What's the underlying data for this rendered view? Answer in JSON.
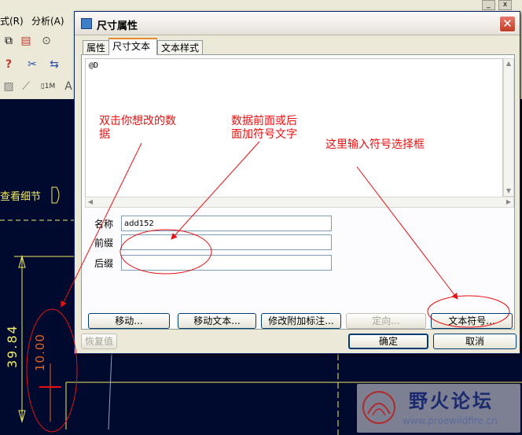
{
  "app": {
    "menus": [
      "式(R)",
      "分析(A)"
    ],
    "detail_label": "查看细节",
    "dimension_values": [
      "39.84",
      "10.00"
    ],
    "toolbar_icons": [
      "copy-icon",
      "pdf-icon",
      "print-preview-icon",
      "help-query-icon",
      "dimension-tool-icon",
      "table-tool-icon",
      "hatch-icon",
      "ruler-icon",
      "scale-icon",
      "annotation-icon"
    ],
    "window_controls": [
      "minimize",
      "close"
    ]
  },
  "dialog": {
    "title": "尺寸属性",
    "tabs": [
      "属性",
      "尺寸文本",
      "文本样式"
    ],
    "active_tab": "尺寸文本",
    "text_value": "@D",
    "fields": {
      "name_label": "名称",
      "name_value": "add152",
      "prefix_label": "前缀",
      "prefix_value": "",
      "suffix_label": "后缀",
      "suffix_value": ""
    },
    "buttons": {
      "move": "移动...",
      "move_text": "移动文本...",
      "modify_attached": "修改附加标注...",
      "orient": "定向...",
      "text_symbol": "文本符号...",
      "restore": "恢复值",
      "ok": "确定",
      "cancel": "取消"
    }
  },
  "annotations": {
    "double_click": "双击你想改的数\n据",
    "prefix_suffix": "数据前面或后\n面加符号文字",
    "symbol_box": "这里输入符号选择框"
  },
  "watermark": {
    "title": "野火论坛",
    "url": "www.proewildfire.cn"
  },
  "colors": {
    "canvas_bg": "#000a2e",
    "cad_line": "#f2ea62",
    "annotation": "#e81010",
    "title_bar_bg": "#f4f2ec",
    "close_button": "#c03c26"
  }
}
